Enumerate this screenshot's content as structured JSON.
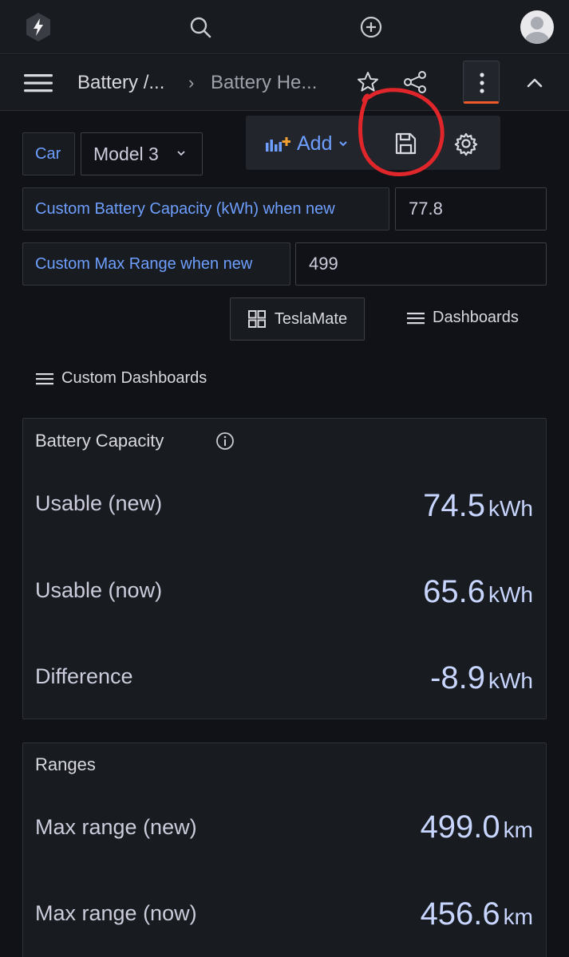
{
  "top_bar": {
    "logo_icon": "grafana-bolt-icon",
    "search_icon": "search-icon",
    "create_icon": "plus-circle-icon",
    "avatar_icon": "user-avatar-icon"
  },
  "nav_bar": {
    "breadcrumb_parent": "Battery /...",
    "breadcrumb_separator": "›",
    "breadcrumb_current": "Battery He...",
    "star_icon": "star-icon",
    "share_icon": "share-icon",
    "more_icon": "kebab-menu-icon",
    "collapse_icon": "chevron-up-icon"
  },
  "dashboard_menu": {
    "add_label": "Add",
    "add_icon": "add-panel-icon",
    "save_icon": "save-icon",
    "settings_icon": "gear-icon",
    "annotation_color": "#e0262a"
  },
  "variables": {
    "car_label": "Car",
    "car_value": "Model 3",
    "capacity_label": "Custom Battery Capacity (kWh) when new",
    "capacity_value": "77.8",
    "range_label": "Custom Max Range when new",
    "range_value": "499"
  },
  "links": {
    "teslamate": "TeslaMate",
    "dashboards": "Dashboards",
    "custom_dashboards": "Custom Dashboards"
  },
  "battery_panel": {
    "title": "Battery Capacity",
    "info_icon": "info-icon",
    "rows": [
      {
        "label": "Usable (new)",
        "value": "74.5",
        "unit": "kWh"
      },
      {
        "label": "Usable (now)",
        "value": "65.6",
        "unit": "kWh"
      },
      {
        "label": "Difference",
        "value": "-8.9",
        "unit": "kWh"
      }
    ]
  },
  "ranges_panel": {
    "title": "Ranges",
    "rows": [
      {
        "label": "Max range (new)",
        "value": "499.0",
        "unit": "km"
      },
      {
        "label": "Max range (now)",
        "value": "456.6",
        "unit": "km"
      }
    ]
  },
  "colors": {
    "background": "#111217",
    "panel": "#181b1f",
    "accent_blue": "#6e9fff",
    "stat_value": "#c8d6ff",
    "active_underline": "#f05a28"
  }
}
